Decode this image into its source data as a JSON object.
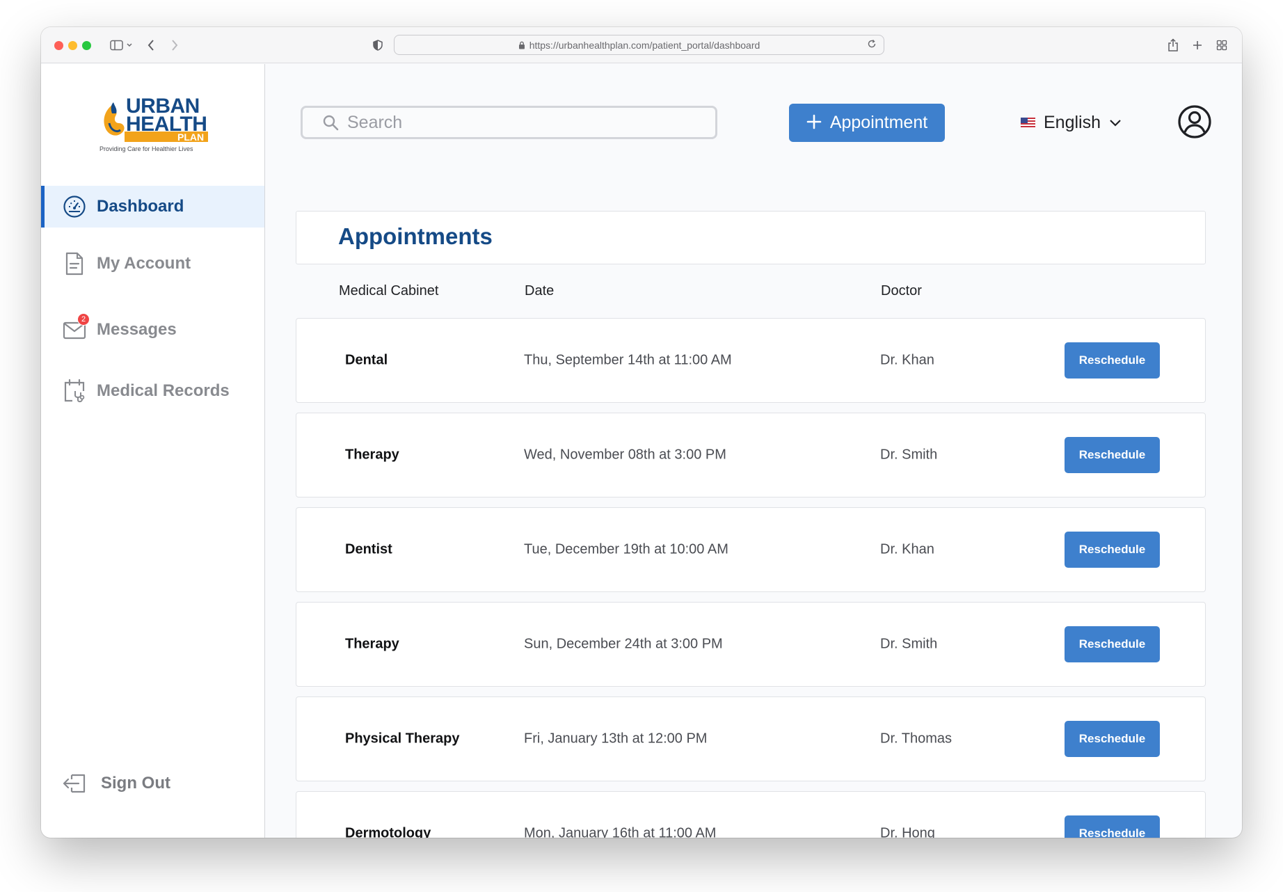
{
  "browser": {
    "url": "https://urbanhealthplan.com/patient_portal/dashboard"
  },
  "logo": {
    "line1": "URBAN",
    "line2": "HEALTH",
    "line3": "PLAN",
    "tagline": "Providing Care for Healthier Lives"
  },
  "sidebar": {
    "items": [
      {
        "label": "Dashboard",
        "icon": "speedometer-icon",
        "active": true
      },
      {
        "label": "My Account",
        "icon": "document-icon"
      },
      {
        "label": "Messages",
        "icon": "envelope-icon",
        "badge": "2"
      },
      {
        "label": "Medical Records",
        "icon": "calendar-stethoscope-icon"
      }
    ],
    "signout": {
      "label": "Sign Out",
      "icon": "sign-out-icon"
    }
  },
  "header": {
    "search_placeholder": "Search",
    "add_appointment_label": "Appointment",
    "language": "English"
  },
  "appointments": {
    "title": "Appointments",
    "columns": [
      "Medical Cabinet",
      "Date",
      "Doctor"
    ],
    "rows": [
      {
        "cabinet": "Dental",
        "date": "Thu, September 14th at 11:00 AM",
        "doctor": "Dr. Khan",
        "action": "Reschedule"
      },
      {
        "cabinet": "Therapy",
        "date": "Wed, November 08th at 3:00 PM",
        "doctor": "Dr. Smith",
        "action": "Reschedule"
      },
      {
        "cabinet": "Dentist",
        "date": "Tue, December 19th at 10:00 AM",
        "doctor": "Dr. Khan",
        "action": "Reschedule"
      },
      {
        "cabinet": "Therapy",
        "date": "Sun, December 24th at 3:00 PM",
        "doctor": "Dr. Smith",
        "action": "Reschedule"
      },
      {
        "cabinet": "Physical Therapy",
        "date": "Fri, January 13th at 12:00 PM",
        "doctor": "Dr. Thomas",
        "action": "Reschedule"
      },
      {
        "cabinet": "Dermotology",
        "date": "Mon, January 16th at 11:00 AM",
        "doctor": "Dr. Hong",
        "action": "Reschedule"
      }
    ]
  },
  "colors": {
    "brand_blue": "#154a86",
    "button_blue": "#3e80cd",
    "active_bg": "#e8f2fd",
    "logo_orange": "#f2a31b"
  }
}
